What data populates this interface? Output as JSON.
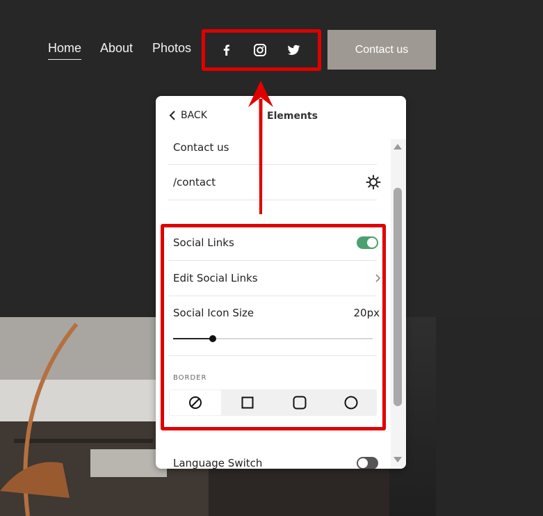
{
  "nav": {
    "items": [
      {
        "label": "Home",
        "active": true
      },
      {
        "label": "About",
        "active": false
      },
      {
        "label": "Photos",
        "active": false
      }
    ],
    "social_icons": [
      "facebook-icon",
      "instagram-icon",
      "twitter-icon"
    ],
    "cta_label": "Contact us"
  },
  "panel": {
    "back_label": "BACK",
    "title": "Elements",
    "button_text": "Contact us",
    "button_link": "/contact",
    "social_links": {
      "label": "Social Links",
      "enabled": true
    },
    "edit_social_links_label": "Edit Social Links",
    "icon_size": {
      "label": "Social Icon Size",
      "value_label": "20px",
      "level": 0.2
    },
    "border": {
      "label": "BORDER",
      "options": [
        "none",
        "square",
        "rounded",
        "circle"
      ],
      "selected": "none"
    },
    "language_switch": {
      "label": "Language Switch",
      "enabled": false
    }
  },
  "colors": {
    "header_bg": "#272727",
    "cta_bg": "#9e9a93",
    "toggle_on": "#4aa06e",
    "toggle_off": "#555555",
    "annotation": "#e00000"
  }
}
